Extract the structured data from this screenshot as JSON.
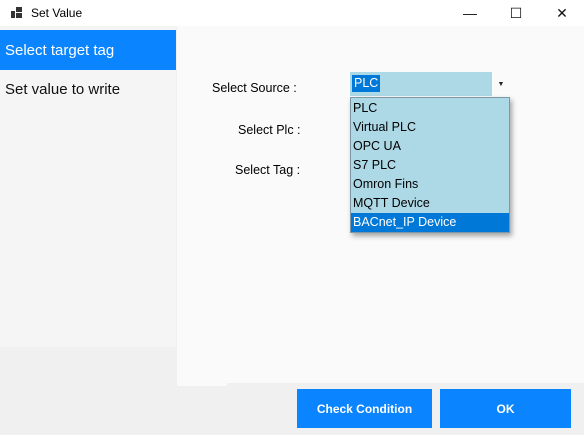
{
  "window": {
    "title": "Set Value",
    "controls": {
      "minimize": "—",
      "maximize": "☐",
      "close": "✕"
    }
  },
  "sidebar": {
    "items": [
      {
        "label": "Select target tag",
        "active": true
      },
      {
        "label": "Set value to write",
        "active": false
      }
    ]
  },
  "form": {
    "source_label": "Select Source :",
    "plc_label": "Select Plc :",
    "tag_label": "Select Tag :",
    "source_value": "PLC"
  },
  "dropdown": {
    "options": [
      "PLC",
      "Virtual PLC",
      "OPC UA",
      "S7 PLC",
      "Omron Fins",
      "MQTT Device",
      "BACnet_IP Device"
    ],
    "highlighted": "BACnet_IP Device"
  },
  "buttons": {
    "check_condition": "Check Condition",
    "ok": "OK"
  },
  "colors": {
    "accent": "#0a84ff",
    "selection": "#0078d7",
    "list_bg": "#add8e6"
  }
}
